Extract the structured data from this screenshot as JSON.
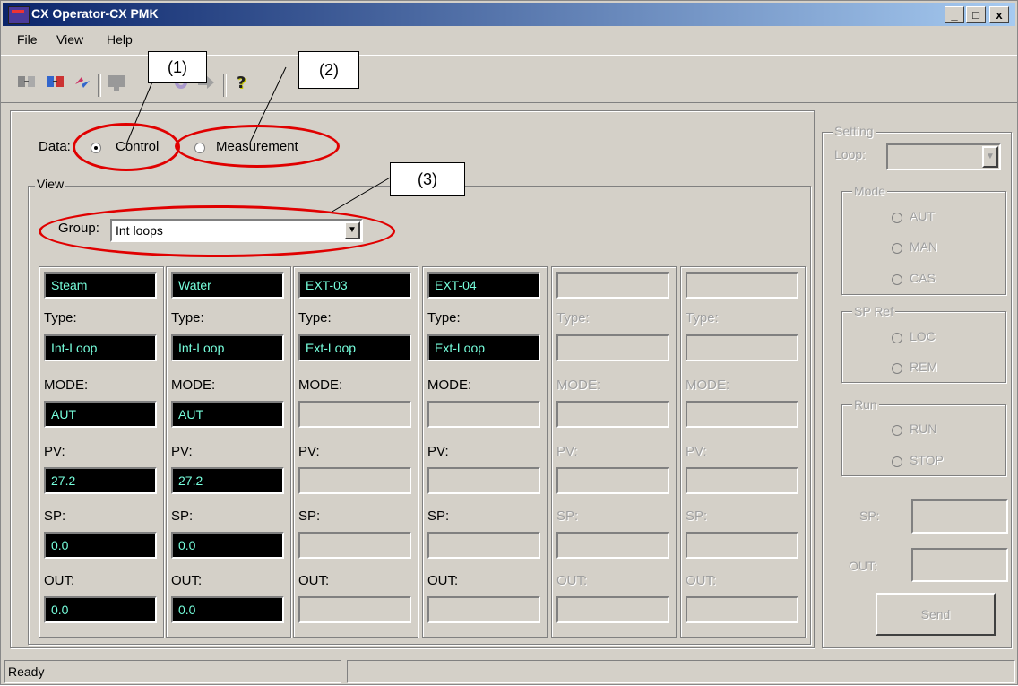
{
  "window": {
    "title": "CX Operator-CX PMK",
    "min": "_",
    "max": "□",
    "close": "x"
  },
  "menu": {
    "file": "File",
    "view": "View",
    "help": "Help"
  },
  "callouts": {
    "c1": "(1)",
    "c2": "(2)",
    "c3": "(3)"
  },
  "data_select": {
    "label": "Data:",
    "control": "Control",
    "measurement": "Measurement"
  },
  "view": {
    "legend": "View",
    "group_label": "Group:",
    "group_value": "Int loops"
  },
  "field_labels": {
    "type": "Type:",
    "mode": "MODE:",
    "pv": "PV:",
    "sp": "SP:",
    "out": "OUT:"
  },
  "loops": [
    {
      "name": "Steam",
      "type": "Int-Loop",
      "mode": "AUT",
      "pv": "27.2",
      "sp": "0.0",
      "out": "0.0"
    },
    {
      "name": "Water",
      "type": "Int-Loop",
      "mode": "AUT",
      "pv": "27.2",
      "sp": "0.0",
      "out": "0.0"
    },
    {
      "name": "EXT-03",
      "type": "Ext-Loop",
      "mode": "",
      "pv": "",
      "sp": "",
      "out": ""
    },
    {
      "name": "EXT-04",
      "type": "Ext-Loop",
      "mode": "",
      "pv": "",
      "sp": "",
      "out": ""
    },
    {
      "name": "",
      "type": "",
      "mode": "",
      "pv": "",
      "sp": "",
      "out": ""
    },
    {
      "name": "",
      "type": "",
      "mode": "",
      "pv": "",
      "sp": "",
      "out": ""
    }
  ],
  "setting": {
    "legend": "Setting",
    "loop_label": "Loop:",
    "mode_legend": "Mode",
    "aut": "AUT",
    "man": "MAN",
    "cas": "CAS",
    "spref_legend": "SP Ref",
    "loc": "LOC",
    "rem": "REM",
    "run_legend": "Run",
    "run": "RUN",
    "stop": "STOP",
    "sp_label": "SP:",
    "out_label": "OUT:",
    "send": "Send"
  },
  "status": {
    "text": "Ready"
  },
  "colors": {
    "annotation": "#e00000",
    "value_text": "#77ddcc"
  }
}
